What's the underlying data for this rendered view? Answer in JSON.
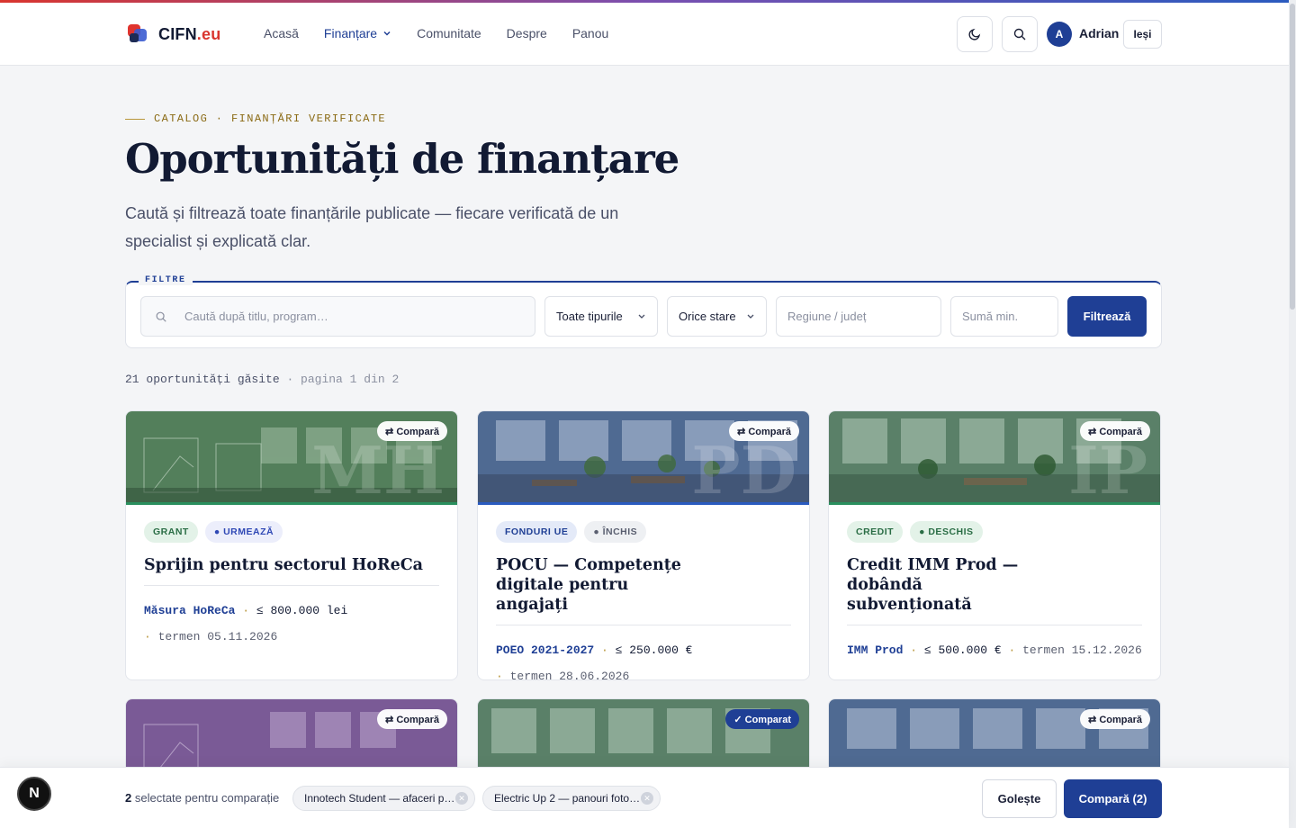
{
  "brand": {
    "name": "CIFN",
    "tld": ".eu"
  },
  "nav": {
    "home": "Acasă",
    "funding": "Finanțare",
    "community": "Comunitate",
    "about": "Despre",
    "panel": "Panou"
  },
  "user": {
    "initial": "A",
    "name": "Adrian",
    "logout": "Ieși"
  },
  "hero": {
    "eyebrow": "CATALOG · FINANȚĂRI VERIFICATE",
    "title": "Oportunități de finanțare",
    "subtitle": "Caută și filtrează toate finanțările publicate — fiecare verificată de un specialist și explicată clar."
  },
  "filters": {
    "legend": "FILTRE",
    "search_placeholder": "Caută după titlu, program…",
    "type_value": "Toate tipurile",
    "status_value": "Orice stare",
    "region_placeholder": "Regiune / județ",
    "amount_placeholder": "Sumă min.",
    "submit": "Filtrează"
  },
  "results": {
    "count": "21 oportunități găsite",
    "page": "· pagina 1 din 2"
  },
  "cards": [
    {
      "type": "GRANT",
      "status": "● URMEAZĂ",
      "title": "Sprijin pentru sectorul HoReCa",
      "program": "Măsura HoReCa",
      "amount": "≤ 800.000 lei",
      "deadline": "termen 05.11.2026",
      "compare": "⇄ Compară",
      "watermark": "MH"
    },
    {
      "type": "FONDURI UE",
      "status": "● ÎNCHIS",
      "title": "POCU — Competențe digitale pentru angajați",
      "program": "POEO 2021-2027",
      "amount": "≤ 250.000 €",
      "deadline": "termen 28.06.2026",
      "compare": "⇄ Compară",
      "watermark": "PD"
    },
    {
      "type": "CREDIT",
      "status": "● DESCHIS",
      "title": "Credit IMM Prod — dobândă subvenționată",
      "program": "IMM Prod",
      "amount": "≤ 500.000 €",
      "deadline": "termen 15.12.2026",
      "compare": "⇄ Compară",
      "watermark": "IP"
    },
    {
      "compare": "⇄ Compară"
    },
    {
      "compare": "✓ Comparat"
    },
    {
      "compare": "⇄ Compară"
    }
  ],
  "compare_bar": {
    "count": "2",
    "label": "selectate pentru comparație",
    "chips": [
      "Innotech Student — afaceri p…",
      "Electric Up 2 — panouri foto…"
    ],
    "clear": "Golește",
    "submit": "Compară (2)"
  },
  "badge": "N",
  "colors": {
    "primary": "#1f3f95",
    "accent_red": "#d9352e",
    "gold": "#b8963a"
  }
}
